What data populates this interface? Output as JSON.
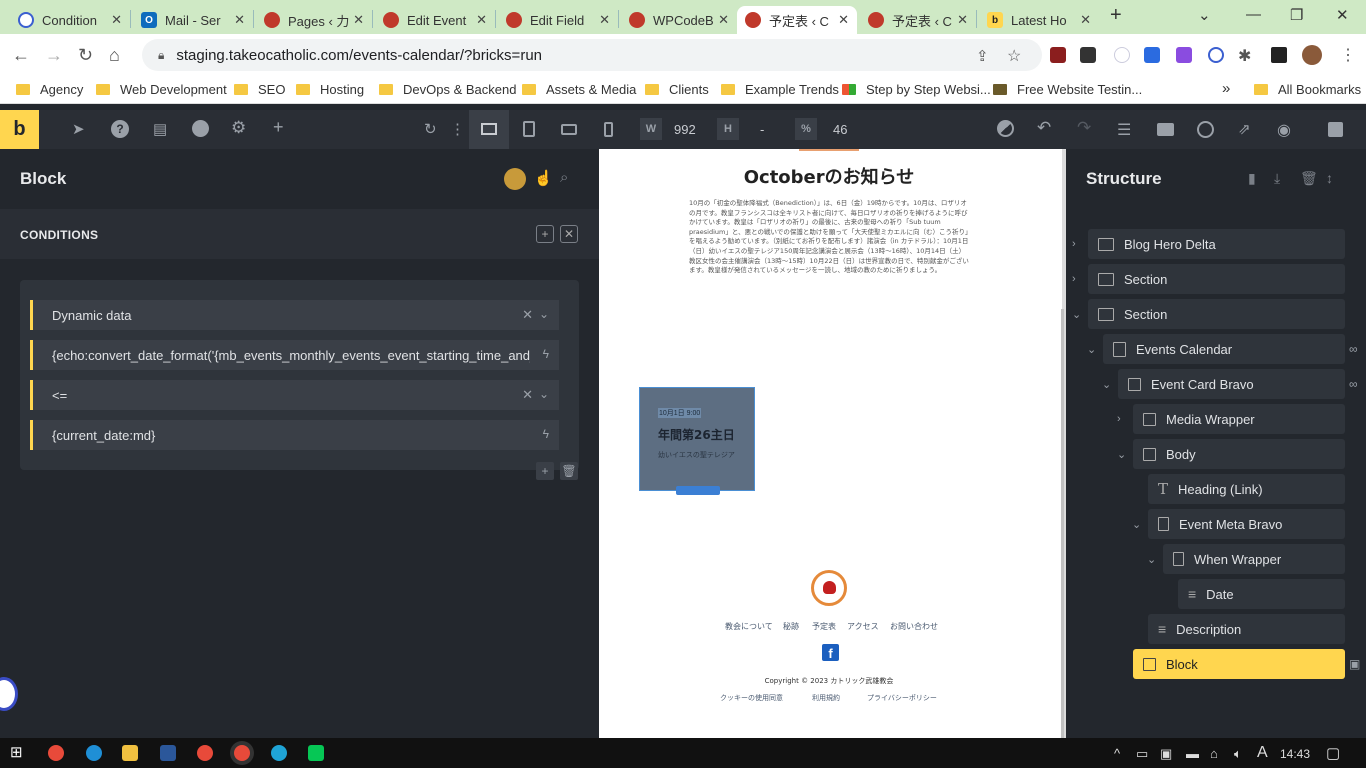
{
  "browser": {
    "tabs": [
      {
        "title": "Condition",
        "color": "#3b5fd0",
        "fav": "◯"
      },
      {
        "title": "Mail - Ser",
        "color": "#0f6cbd",
        "fav": "O"
      },
      {
        "title": "Pages ‹ 力",
        "color": "#c0392b",
        "fav": "◆"
      },
      {
        "title": "Edit Event",
        "color": "#c0392b",
        "fav": "◆"
      },
      {
        "title": "Edit Field",
        "color": "#c0392b",
        "fav": "◆"
      },
      {
        "title": "WPCodeB",
        "color": "#c0392b",
        "fav": "◆"
      },
      {
        "title": "予定表 ‹ C",
        "color": "#c0392b",
        "fav": "◆"
      },
      {
        "title": "予定表 ‹ C",
        "color": "#c0392b",
        "fav": "◆"
      },
      {
        "title": "Latest Ho",
        "color": "#ffd64f",
        "fav": "b"
      }
    ],
    "new_tab": "+",
    "url": "staging.takeocatholic.com/events-calendar/?bricks=run",
    "bookmarks": [
      "Agency",
      "Web Development",
      "SEO",
      "Hosting",
      "DevOps & Backend",
      "Assets & Media",
      "Clients",
      "Example Trends",
      "Step by Step Websi...",
      "Free Website Testin..."
    ],
    "bookmarks_more": "»",
    "all_bookmarks": "All Bookmarks"
  },
  "toolbar": {
    "logo": "b",
    "width_label": "W",
    "width_value": "992",
    "height_label": "H",
    "height_value": "-",
    "percent_label": "%",
    "percent_value": "46"
  },
  "left_panel": {
    "title": "Block",
    "section": "CONDITIONS",
    "conditions": [
      {
        "text": "Dynamic data",
        "type": "select"
      },
      {
        "text": "{echo:convert_date_format('{mb_events_monthly_events_event_starting_time_and_date}')}",
        "type": "dynamic"
      },
      {
        "text": "<=",
        "type": "select"
      },
      {
        "text": "{current_date:md}",
        "type": "dynamic"
      }
    ]
  },
  "canvas": {
    "title": "Octoberのお知らせ",
    "body": "10月の「初金の聖体降福式（Benediction）」は、6日（金）19時からです。10月は、ロザリオの月です。教皇フランシスコは全キリスト者に向けて、毎日ロザリオの祈りを捧げるように呼びかけています。教皇は「ロザリオの祈り」の最後に、古来の聖母への祈り「Sub tuum praesidium」と、悪との戦いでの保護と助けを願って「大天使聖ミカエルに向（む）こう祈り」を唱えるよう勧めています。（別紙にてお祈りを配布します）諸演会（in カテドラル）：10月1日（日）幼いイエスの聖テレジア150周年記念講演会と展示会（13時〜16時）、10月14日（土）教区女性の会主催講演会（13時〜15時）10月22日（日）は世界宣教の日で、特別献金がございます。教皇様が発信されているメッセージを一読し、地域の教のために祈りましょう。",
    "card_date": "10月1日 9:00",
    "card_heading": "年間第26主日",
    "card_desc": "幼いイエスの聖テレジア",
    "footer_nav": [
      "教会について",
      "秘跡",
      "予定表",
      "アクセス",
      "お問い合わせ"
    ],
    "facebook": "f",
    "copyright": "Copyright © 2023 カトリック武雄教会",
    "footer_links": [
      "クッキーの使用同意",
      "利用規約",
      "プライバシーポリシー"
    ]
  },
  "structure": {
    "title": "Structure",
    "items": [
      {
        "label": "Blog Hero Delta"
      },
      {
        "label": "Section"
      },
      {
        "label": "Section"
      },
      {
        "label": "Events Calendar"
      },
      {
        "label": "Event Card Bravo"
      },
      {
        "label": "Media Wrapper"
      },
      {
        "label": "Body"
      },
      {
        "label": "Heading (Link)"
      },
      {
        "label": "Event Meta Bravo"
      },
      {
        "label": "When Wrapper"
      },
      {
        "label": "Date"
      },
      {
        "label": "Description"
      },
      {
        "label": "Block"
      }
    ]
  },
  "taskbar": {
    "time": "14:43",
    "ime": "A"
  }
}
